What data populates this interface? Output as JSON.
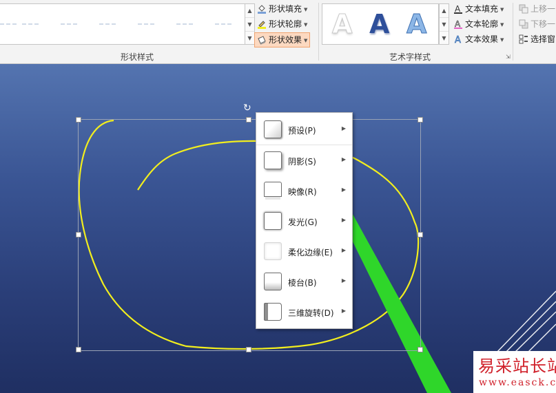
{
  "ribbon": {
    "shape_styles": {
      "group_label": "形状样式",
      "commands": [
        {
          "label": "形状填充",
          "icon": "paint-bucket-icon"
        },
        {
          "label": "形状轮廓",
          "icon": "pencil-outline-icon"
        },
        {
          "label": "形状效果",
          "icon": "shape-effects-icon",
          "active": true
        }
      ]
    },
    "wordart_styles": {
      "group_label": "艺术字样式",
      "samples": [
        "A",
        "A",
        "A"
      ],
      "commands": [
        {
          "label": "文本填充",
          "icon": "text-fill-icon"
        },
        {
          "label": "文本轮廓",
          "icon": "text-outline-icon"
        },
        {
          "label": "文本效果",
          "icon": "text-effects-icon"
        }
      ]
    },
    "arrange": {
      "commands": [
        {
          "label": "上移一",
          "icon": "bring-forward-icon",
          "enabled": false
        },
        {
          "label": "下移一",
          "icon": "send-backward-icon",
          "enabled": false
        },
        {
          "label": "选择窗",
          "icon": "selection-pane-icon",
          "enabled": true
        }
      ]
    }
  },
  "effects_menu": {
    "items": [
      {
        "label": "预设(P)",
        "icon": "preset-effect-icon"
      },
      {
        "label": "阴影(S)",
        "icon": "shadow-effect-icon"
      },
      {
        "label": "映像(R)",
        "icon": "reflection-effect-icon"
      },
      {
        "label": "发光(G)",
        "icon": "glow-effect-icon"
      },
      {
        "label": "柔化边缘(E)",
        "icon": "soft-edges-effect-icon"
      },
      {
        "label": "棱台(B)",
        "icon": "bevel-effect-icon"
      },
      {
        "label": "三维旋转(D)",
        "icon": "3d-rotation-effect-icon"
      }
    ]
  },
  "watermark": {
    "title": "易采站长站",
    "url": "www.easck.com"
  },
  "colors": {
    "ribbon_bg": "#f3f3f3",
    "slide_top": "#5474b0",
    "slide_bottom": "#1f2f62",
    "scribble": "#f2ee1e",
    "arrow": "#2fd62a",
    "active_cmd": "#fcd9c1"
  }
}
